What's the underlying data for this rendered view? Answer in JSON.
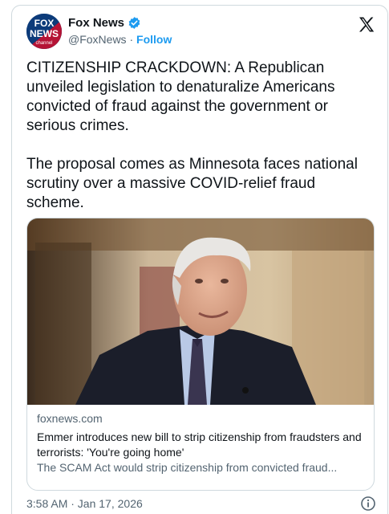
{
  "author": {
    "avatar_text": [
      "FOX",
      "NEWS",
      "channel"
    ],
    "display_name": "Fox News",
    "handle": "@FoxNews",
    "separator": "·",
    "follow_label": "Follow"
  },
  "tweet": {
    "text": "CITIZENSHIP CRACKDOWN: A Republican unveiled legislation to denaturalize Americans convicted of fraud against the government or serious crimes.\n\nThe proposal comes as Minnesota faces national scrutiny over a massive COVID-relief fraud scheme."
  },
  "link_card": {
    "domain": "foxnews.com",
    "headline": "Emmer introduces new bill to strip citizenship from fraudsters and terrorists: 'You're going home'",
    "description": "The SCAM Act would strip citizenship from convicted fraud..."
  },
  "footer": {
    "timestamp": "3:58 AM · Jan 17, 2026"
  },
  "icons": {
    "verified": "verified-badge-icon",
    "platform": "x-logo-icon",
    "info": "info-icon"
  },
  "colors": {
    "accent": "#1d9bf0",
    "text": "#0f1419",
    "muted": "#536471",
    "border": "#cfd9de"
  }
}
